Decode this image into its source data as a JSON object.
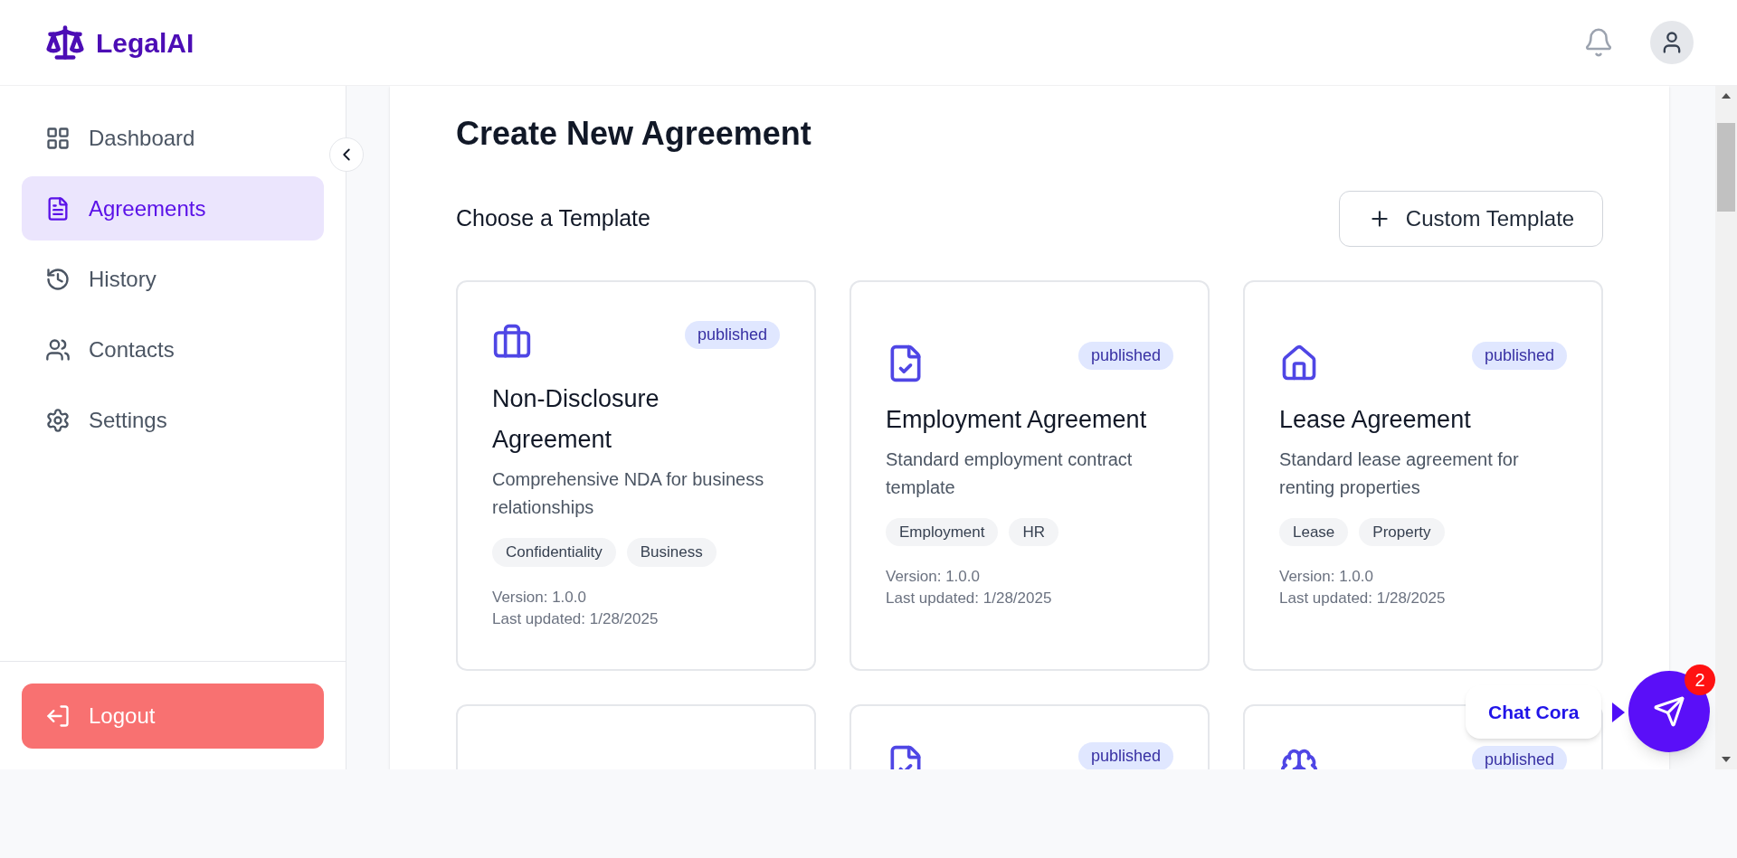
{
  "brand": {
    "name": "LegalAI"
  },
  "sidebar": {
    "items": [
      {
        "label": "Dashboard",
        "kind": "dashboard",
        "selected": false
      },
      {
        "label": "Agreements",
        "kind": "document",
        "selected": true
      },
      {
        "label": "History",
        "kind": "history",
        "selected": false
      },
      {
        "label": "Contacts",
        "kind": "contacts",
        "selected": false
      },
      {
        "label": "Settings",
        "kind": "settings",
        "selected": false
      }
    ],
    "logout": "Logout"
  },
  "page": {
    "title": "Create New Agreement",
    "subtitle": "Choose a Template",
    "custom_button": "Custom Template"
  },
  "templates": [
    {
      "kind": "briefcase",
      "status": "published",
      "title": "Non-Disclosure Agreement",
      "description": "Comprehensive NDA for business relationships",
      "tags": [
        "Confidentiality",
        "Business"
      ],
      "version": "Version: 1.0.0",
      "updated": "Last updated: 1/28/2025"
    },
    {
      "kind": "file-check",
      "status": "published",
      "title": "Employment Agreement",
      "description": "Standard employment contract template",
      "tags": [
        "Employment",
        "HR"
      ],
      "version": "Version: 1.0.0",
      "updated": "Last updated: 1/28/2025"
    },
    {
      "kind": "home",
      "status": "published",
      "title": "Lease Agreement",
      "description": "Standard lease agreement for renting properties",
      "tags": [
        "Lease",
        "Property"
      ],
      "version": "Version: 1.0.0",
      "updated": "Last updated: 1/28/2025"
    },
    {
      "kind": "blank"
    },
    {
      "kind": "file-check",
      "status": "published"
    },
    {
      "kind": "brain",
      "status": "published"
    }
  ],
  "chat": {
    "label": "Chat Cora",
    "badge": "2"
  }
}
